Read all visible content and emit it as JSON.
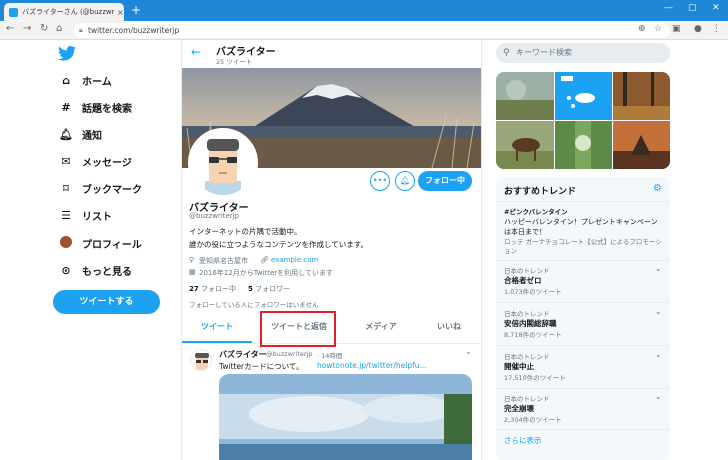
{
  "browser": {
    "tab_title": "バズライターさん (@buzzwriterjp) / T",
    "tab_close": "×",
    "new_tab": "+",
    "url": "twitter.com/buzzwriterjp",
    "accent_color": "#1e88d6"
  },
  "nav": {
    "items": [
      {
        "label": "ホーム",
        "icon": "home-icon"
      },
      {
        "label": "話題を検索",
        "icon": "hashtag-icon"
      },
      {
        "label": "通知",
        "icon": "bell-icon"
      },
      {
        "label": "メッセージ",
        "icon": "mail-icon"
      },
      {
        "label": "ブックマーク",
        "icon": "bookmark-icon"
      },
      {
        "label": "リスト",
        "icon": "list-icon"
      },
      {
        "label": "プロフィール",
        "icon": "avatar-icon"
      },
      {
        "label": "もっと見る",
        "icon": "more-icon"
      }
    ],
    "tweet_button": "ツイートする",
    "brand_color": "#1da1f2"
  },
  "header": {
    "name": "バズライター",
    "tweet_count": "25 ツイート"
  },
  "profile": {
    "name": "バズライター",
    "handle": "@buzzwriterjp",
    "bio_line1": "インターネットの片隅で活動中。",
    "bio_line2": "誰かの役に立つようなコンテンツを作成しています。",
    "location": "愛知県名古屋市",
    "website": "example.com",
    "joined": "2016年12月からTwitterを利用しています",
    "following_count": "27",
    "following_label": "フォロー中",
    "followers_count": "5",
    "followers_label": "フォロワー",
    "follower_note": "フォローしている人にフォロワーはいません",
    "follow_button": "フォロー中",
    "more_button": "•••"
  },
  "tabs": [
    "ツイート",
    "ツイートと返信",
    "メディア",
    "いいね"
  ],
  "tweet": {
    "name": "バズライター",
    "handle": "@buzzwriterjp",
    "time": "· 14時間",
    "text": "Twitterカードについて。",
    "link": "howtonote.jp/twitter/helpfu..."
  },
  "search": {
    "placeholder": "キーワード検索"
  },
  "trends": {
    "title": "おすすめトレンド",
    "promoted": {
      "tag": "#ピンクバレンタイン",
      "text": "ハッピーバレンタイン！プレゼントキャンペーンは本日まで！",
      "sponsor": "ロッテ ガーナチョコレート【公式】によるプロモーション"
    },
    "items": [
      {
        "context": "日本のトレンド",
        "name": "合格者ゼロ",
        "count": "1,073件のツイート"
      },
      {
        "context": "日本のトレンド",
        "name": "安倍内閣総辞職",
        "count": "8,718件のツイート"
      },
      {
        "context": "日本のトレンド",
        "name": "開催中止",
        "count": "17,510件のツイート"
      },
      {
        "context": "日本のトレンド",
        "name": "完全崩壊",
        "count": "2,304件のツイート"
      }
    ],
    "show_more": "さらに表示"
  }
}
